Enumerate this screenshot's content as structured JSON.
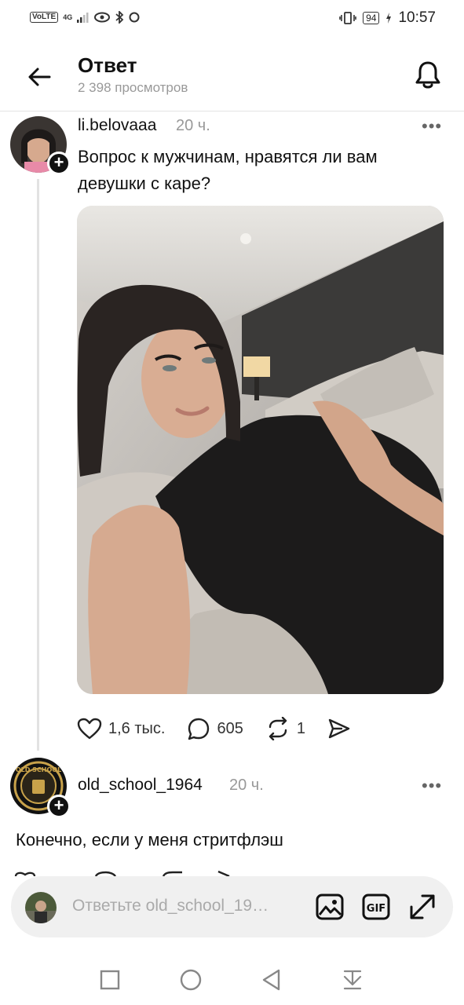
{
  "status_bar": {
    "network_type": "VoLTE",
    "network_gen": "4G",
    "battery": "94",
    "time": "10:57"
  },
  "header": {
    "title": "Ответ",
    "views": "2 398 просмотров"
  },
  "post": {
    "username": "li.belovaaa",
    "time": "20 ч.",
    "text": "Вопрос к мужчинам, нравятся ли вам девушки с каре?",
    "likes": "1,6 тыс.",
    "comments": "605",
    "reposts": "1"
  },
  "reply": {
    "username": "old_school_1964",
    "time": "20 ч.",
    "text": "Конечно, если у меня стритфлэш",
    "avatar_text": "OLD SCHOOL"
  },
  "reply_bar": {
    "placeholder": "Ответьте old_school_19…"
  },
  "colors": {
    "accent": "#111111",
    "muted": "#999999",
    "background": "#ffffff",
    "input_bg": "#f0f0f0"
  }
}
